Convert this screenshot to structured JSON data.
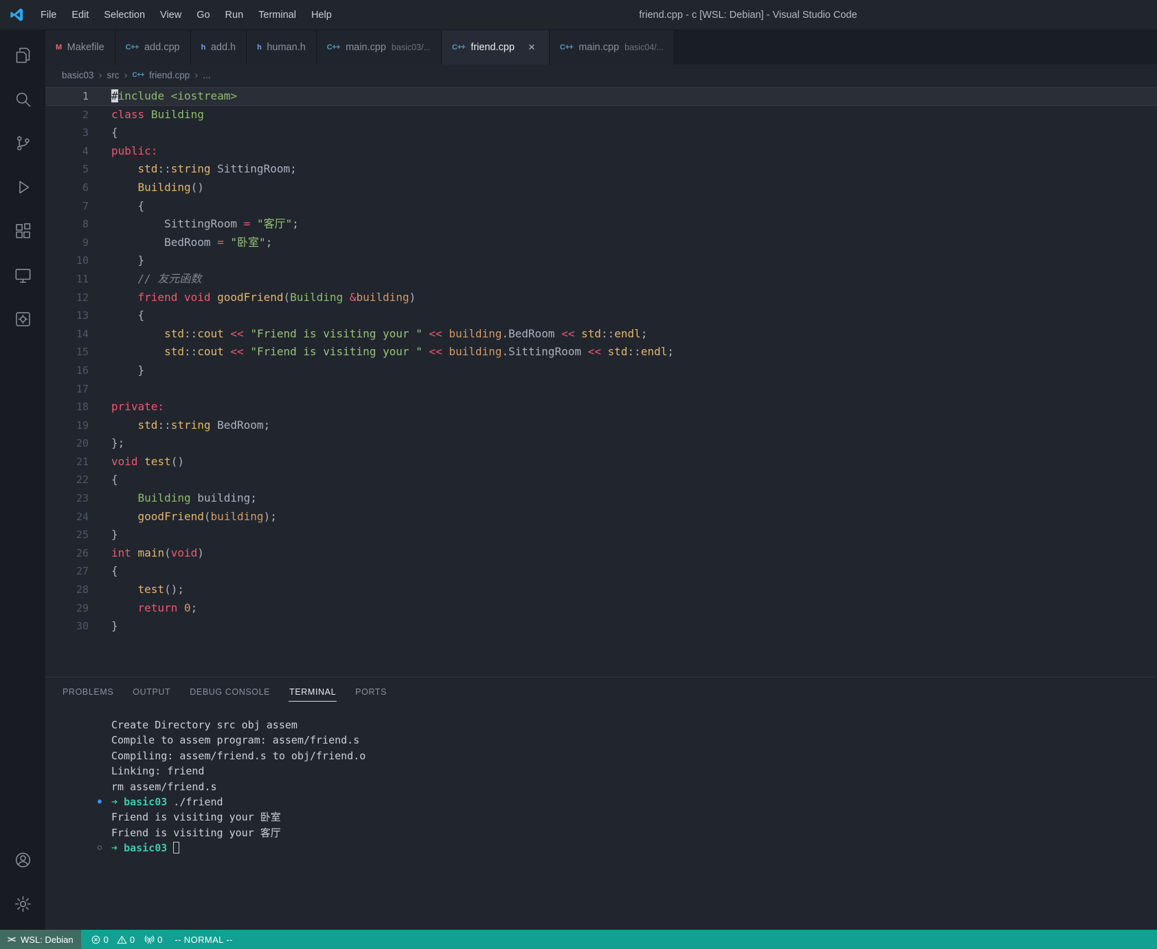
{
  "colors": {
    "status_bar": "#12a093",
    "remote_segment": "#416b61",
    "accent_blue": "#3b8eea",
    "keyword_red": "#ef596f",
    "string_green": "#98c379",
    "function_gold": "#e2b86b"
  },
  "title_bar": {
    "menus": [
      "File",
      "Edit",
      "Selection",
      "View",
      "Go",
      "Run",
      "Terminal",
      "Help"
    ],
    "title": "friend.cpp - c [WSL: Debian] - Visual Studio Code"
  },
  "file_icon_glyphs": {
    "cpp": "C++",
    "h": "h",
    "mk": "M"
  },
  "tabs": [
    {
      "label": "Makefile",
      "icon": "mk",
      "active": false
    },
    {
      "label": "add.cpp",
      "icon": "cpp",
      "active": false
    },
    {
      "label": "add.h",
      "icon": "h",
      "active": false
    },
    {
      "label": "human.h",
      "icon": "h",
      "active": false
    },
    {
      "label": "main.cpp",
      "icon": "cpp",
      "detail": "basic03/...",
      "active": false
    },
    {
      "label": "friend.cpp",
      "icon": "cpp",
      "active": true
    },
    {
      "label": "main.cpp",
      "icon": "cpp",
      "detail": "basic04/...",
      "active": false
    }
  ],
  "breadcrumb": [
    {
      "label": "basic03"
    },
    {
      "label": "src"
    },
    {
      "label": "friend.cpp",
      "icon": "cpp"
    },
    {
      "label": "..."
    }
  ],
  "editor": {
    "active_line": 1,
    "lines": [
      [
        [
          "#",
          "cursor"
        ],
        [
          "include",
          "t"
        ],
        [
          " ",
          ""
        ],
        [
          "<iostream>",
          "t"
        ]
      ],
      [
        [
          "class",
          "k"
        ],
        [
          " ",
          ""
        ],
        [
          "Building",
          "t"
        ]
      ],
      [
        [
          "{",
          ""
        ]
      ],
      [
        [
          "public:",
          "k"
        ]
      ],
      [
        [
          "    ",
          ""
        ],
        [
          "std",
          "f"
        ],
        [
          "::",
          ""
        ],
        [
          "string",
          "f"
        ],
        [
          " SittingRoom;",
          ""
        ]
      ],
      [
        [
          "    ",
          ""
        ],
        [
          "Building",
          "f"
        ],
        [
          "()",
          ""
        ]
      ],
      [
        [
          "    {",
          ""
        ]
      ],
      [
        [
          "        SittingRoom ",
          ""
        ],
        [
          "=",
          "k"
        ],
        [
          " ",
          ""
        ],
        [
          "\"客厅\"",
          "s"
        ],
        [
          ";",
          ""
        ]
      ],
      [
        [
          "        BedRoom ",
          ""
        ],
        [
          "=",
          "k"
        ],
        [
          " ",
          ""
        ],
        [
          "\"卧室\"",
          "s"
        ],
        [
          ";",
          ""
        ]
      ],
      [
        [
          "    }",
          ""
        ]
      ],
      [
        [
          "    ",
          ""
        ],
        [
          "// 友元函数",
          "c"
        ]
      ],
      [
        [
          "    ",
          ""
        ],
        [
          "friend",
          "k"
        ],
        [
          " ",
          ""
        ],
        [
          "void",
          "k"
        ],
        [
          " ",
          ""
        ],
        [
          "goodFriend",
          "f"
        ],
        [
          "(",
          ""
        ],
        [
          "Building",
          "t"
        ],
        [
          " ",
          ""
        ],
        [
          "&",
          "k"
        ],
        [
          "building",
          "o"
        ],
        [
          ")",
          ""
        ]
      ],
      [
        [
          "    {",
          ""
        ]
      ],
      [
        [
          "        ",
          ""
        ],
        [
          "std",
          "f"
        ],
        [
          "::",
          ""
        ],
        [
          "cout",
          "f"
        ],
        [
          " ",
          ""
        ],
        [
          "<<",
          "k"
        ],
        [
          " ",
          ""
        ],
        [
          "\"Friend is visiting your \"",
          "s"
        ],
        [
          " ",
          ""
        ],
        [
          "<<",
          "k"
        ],
        [
          " ",
          ""
        ],
        [
          "building",
          "o"
        ],
        [
          ".BedRoom",
          ""
        ],
        [
          " ",
          ""
        ],
        [
          "<<",
          "k"
        ],
        [
          " ",
          ""
        ],
        [
          "std",
          "f"
        ],
        [
          "::",
          ""
        ],
        [
          "endl",
          "f"
        ],
        [
          ";",
          ""
        ]
      ],
      [
        [
          "        ",
          ""
        ],
        [
          "std",
          "f"
        ],
        [
          "::",
          ""
        ],
        [
          "cout",
          "f"
        ],
        [
          " ",
          ""
        ],
        [
          "<<",
          "k"
        ],
        [
          " ",
          ""
        ],
        [
          "\"Friend is visiting your \"",
          "s"
        ],
        [
          " ",
          ""
        ],
        [
          "<<",
          "k"
        ],
        [
          " ",
          ""
        ],
        [
          "building",
          "o"
        ],
        [
          ".SittingRoom",
          ""
        ],
        [
          " ",
          ""
        ],
        [
          "<<",
          "k"
        ],
        [
          " ",
          ""
        ],
        [
          "std",
          "f"
        ],
        [
          "::",
          ""
        ],
        [
          "endl",
          "f"
        ],
        [
          ";",
          ""
        ]
      ],
      [
        [
          "    }",
          ""
        ]
      ],
      [],
      [
        [
          "private:",
          "k"
        ]
      ],
      [
        [
          "    ",
          ""
        ],
        [
          "std",
          "f"
        ],
        [
          "::",
          ""
        ],
        [
          "string",
          "f"
        ],
        [
          " BedRoom;",
          ""
        ]
      ],
      [
        [
          "};",
          ""
        ]
      ],
      [
        [
          "void",
          "k"
        ],
        [
          " ",
          ""
        ],
        [
          "test",
          "f"
        ],
        [
          "()",
          ""
        ]
      ],
      [
        [
          "{",
          ""
        ]
      ],
      [
        [
          "    ",
          ""
        ],
        [
          "Building",
          "t"
        ],
        [
          " building;",
          ""
        ]
      ],
      [
        [
          "    ",
          ""
        ],
        [
          "goodFriend",
          "f"
        ],
        [
          "(",
          ""
        ],
        [
          "building",
          "o"
        ],
        [
          ");",
          ""
        ]
      ],
      [
        [
          "}",
          ""
        ]
      ],
      [
        [
          "int",
          "k"
        ],
        [
          " ",
          ""
        ],
        [
          "main",
          "f"
        ],
        [
          "(",
          ""
        ],
        [
          "void",
          "k"
        ],
        [
          ")",
          ""
        ]
      ],
      [
        [
          "{",
          ""
        ]
      ],
      [
        [
          "    ",
          ""
        ],
        [
          "test",
          "f"
        ],
        [
          "();",
          ""
        ]
      ],
      [
        [
          "    ",
          ""
        ],
        [
          "return",
          "k"
        ],
        [
          " ",
          ""
        ],
        [
          "0",
          "o"
        ],
        [
          ";",
          ""
        ]
      ],
      [
        [
          "}",
          ""
        ]
      ]
    ]
  },
  "panel": {
    "tabs": [
      "PROBLEMS",
      "OUTPUT",
      "DEBUG CONSOLE",
      "TERMINAL",
      "PORTS"
    ],
    "active_tab": "TERMINAL",
    "terminal": {
      "lines": [
        {
          "segs": [
            [
              "Create Directory src obj assem",
              ""
            ]
          ]
        },
        {
          "segs": [
            [
              "Compile to assem program: assem/friend.s",
              ""
            ]
          ]
        },
        {
          "segs": [
            [
              "Compiling: assem/friend.s to obj/friend.o",
              ""
            ]
          ]
        },
        {
          "segs": [
            [
              "Linking: friend",
              ""
            ]
          ]
        },
        {
          "segs": [
            [
              "rm assem/friend.s",
              ""
            ]
          ]
        },
        {
          "deco": "filled",
          "segs": [
            [
              "➜ ",
              "tg"
            ],
            [
              "basic03",
              "tc"
            ],
            [
              " ./friend",
              ""
            ]
          ]
        },
        {
          "segs": [
            [
              "Friend is visiting your 卧室",
              ""
            ]
          ]
        },
        {
          "segs": [
            [
              "Friend is visiting your 客厅",
              ""
            ]
          ]
        },
        {
          "deco": "hollow",
          "segs": [
            [
              "➜ ",
              "tg"
            ],
            [
              "basic03",
              "tc"
            ],
            [
              " ",
              ""
            ],
            [
              "",
              "tcursor"
            ]
          ]
        }
      ]
    }
  },
  "status_bar": {
    "remote": "WSL: Debian",
    "errors": "0",
    "warnings": "0",
    "ports": "0",
    "mode": "-- NORMAL --"
  }
}
